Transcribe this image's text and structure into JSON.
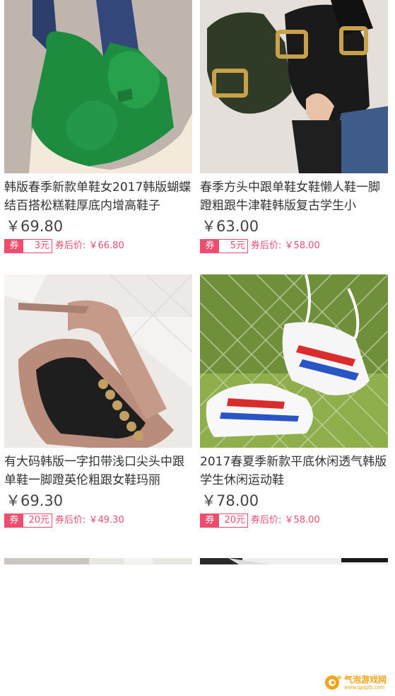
{
  "currency_symbol": "￥",
  "products": [
    {
      "title": "韩版春季新款单鞋女2017韩版蝴蝶结百搭松糕鞋厚底内增高鞋子",
      "price": "￥69.80",
      "coupon_label": "券",
      "coupon_amount": "3元",
      "after_coupon": "券后价: ￥66.80",
      "image_icon": "green-bow-slip-on-shoe-photo"
    },
    {
      "title": "春季方头中跟单鞋女鞋懒人鞋一脚蹬粗跟牛津鞋韩版复古学生小",
      "price": "￥63.00",
      "coupon_label": "券",
      "coupon_amount": "5元",
      "after_coupon": "券后价: ￥58.00",
      "image_icon": "black-buckle-loafer-photo"
    },
    {
      "title": "有大码韩版一字扣带浅口尖头中跟单鞋一脚蹬英伦粗跟女鞋玛丽",
      "price": "￥69.30",
      "coupon_label": "券",
      "coupon_amount": "20元",
      "after_coupon": "券后价: ￥49.30",
      "image_icon": "pink-pointed-flat-photo"
    },
    {
      "title": "2017春夏季新款平底休闲透气韩版学生休闲运动鞋",
      "price": "￥78.00",
      "coupon_label": "券",
      "coupon_amount": "20元",
      "after_coupon": "券后价: ￥58.00",
      "image_icon": "white-sneaker-fence-photo"
    }
  ],
  "watermark": {
    "text": "气泡游戏网",
    "sub": "www.qpgzb.com"
  },
  "colors": {
    "accent": "#ee4d6e",
    "price_text": "#444444",
    "title_text": "#333333"
  }
}
